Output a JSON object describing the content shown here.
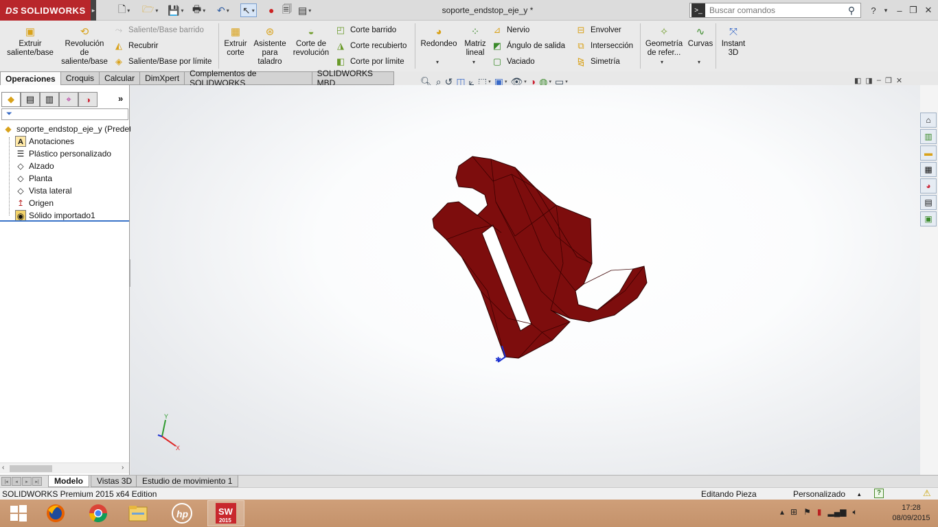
{
  "app": {
    "logo_text": "SOLIDWORKS",
    "logo_prefix": "DS",
    "document_title": "soporte_endstop_eje_y *"
  },
  "search": {
    "placeholder": "Buscar comandos"
  },
  "ribbon": {
    "extrude_boss": "Extruir\nsaliente/base",
    "revolve_boss": "Revolución\nde\nsaliente/base",
    "swept_boss": "Saliente/Base barrido",
    "loft": "Recubrir",
    "boundary_boss": "Saliente/Base por límite",
    "extrude_cut": "Extruir\ncorte",
    "hole_wizard": "Asistente\npara\ntaladro",
    "revolve_cut": "Corte de\nrevolución",
    "swept_cut": "Corte barrido",
    "lofted_cut": "Corte recubierto",
    "boundary_cut": "Corte por límite",
    "fillet": "Redondeo",
    "linear_pattern": "Matriz\nlineal",
    "rib": "Nervio",
    "draft": "Ángulo de salida",
    "shell": "Vaciado",
    "wrap": "Envolver",
    "intersect": "Intersección",
    "mirror": "Simetría",
    "ref_geometry": "Geometría\nde refer...",
    "curves": "Curvas",
    "instant3d": "Instant\n3D"
  },
  "tabs": [
    "Operaciones",
    "Croquis",
    "Calcular",
    "DimXpert",
    "Complementos de SOLIDWORKS",
    "SOLIDWORKS MBD"
  ],
  "tree": {
    "root": "soporte_endstop_eje_y  (Predet",
    "items": [
      "Anotaciones",
      "Plástico personalizado",
      "Alzado",
      "Planta",
      "Vista lateral",
      "Origen",
      "Sólido importado1"
    ]
  },
  "bottom_tabs": [
    "Modelo",
    "Vistas 3D",
    "Estudio de movimiento 1"
  ],
  "status": {
    "edition": "SOLIDWORKS Premium 2015 x64 Edition",
    "mode": "Editando Pieza",
    "units": "Personalizado"
  },
  "triad": {
    "x": "X",
    "y": "Y"
  },
  "taskbar": {
    "sw_badge": "2015",
    "time": "17:28",
    "date": "08/09/2015"
  },
  "colors": {
    "part": "#7d0d0d",
    "part_edge": "#3a0000",
    "brand": "#b8262b",
    "taskbar": "#c99a74"
  }
}
